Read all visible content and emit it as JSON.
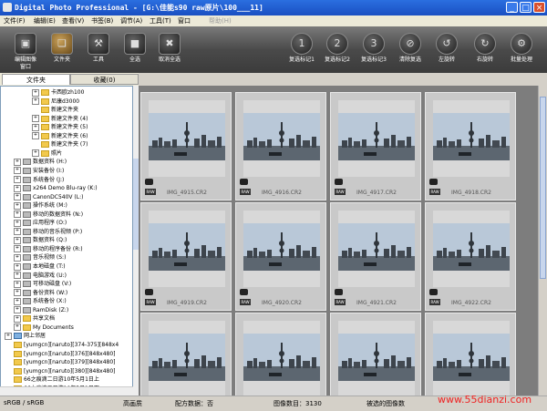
{
  "window": {
    "title": "Digital Photo Professional - [G:\\佳能s90 raw原片\\100___11]"
  },
  "menu": [
    {
      "label": "文件(F)",
      "enabled": true
    },
    {
      "label": "编辑(E)",
      "enabled": true
    },
    {
      "label": "查看(V)",
      "enabled": true
    },
    {
      "label": "书签(B)",
      "enabled": true
    },
    {
      "label": "调节(A)",
      "enabled": true
    },
    {
      "label": "工具(T)",
      "enabled": true
    },
    {
      "label": "窗口",
      "enabled": true
    },
    {
      "label": "帮助(H)",
      "enabled": false
    }
  ],
  "toolbar": {
    "left": [
      {
        "label": "编辑图像\n窗口",
        "icon": "edit-window-icon"
      },
      {
        "label": "文件夹",
        "icon": "folder-icon",
        "active": true
      },
      {
        "label": "工具",
        "icon": "tools-icon"
      },
      {
        "label": "全选",
        "icon": "select-all-icon"
      },
      {
        "label": "取消全选",
        "icon": "deselect-all-icon"
      }
    ],
    "right": [
      {
        "label": "复选标记1",
        "icon": "check-mark-1-icon"
      },
      {
        "label": "复选标记2",
        "icon": "check-mark-2-icon"
      },
      {
        "label": "复选标记3",
        "icon": "check-mark-3-icon"
      },
      {
        "label": "清除复选",
        "icon": "clear-check-icon"
      },
      {
        "label": "左旋转",
        "icon": "rotate-left-icon"
      },
      {
        "label": "右旋转",
        "icon": "rotate-right-icon"
      },
      {
        "label": "批量处理",
        "icon": "batch-process-icon"
      }
    ]
  },
  "tabs": [
    {
      "label": "文件夹",
      "active": true
    },
    {
      "label": "收藏(0)",
      "active": false
    }
  ],
  "tree": [
    {
      "label": "卡西欧zh100",
      "icon": "folder",
      "depth": 3,
      "expander": "+"
    },
    {
      "label": "尼康d3000",
      "icon": "folder",
      "depth": 3,
      "expander": "+"
    },
    {
      "label": "新建文件夹",
      "icon": "folder",
      "depth": 3,
      "expander": ""
    },
    {
      "label": "新建文件夹 (4)",
      "icon": "folder",
      "depth": 3,
      "expander": "+"
    },
    {
      "label": "新建文件夹 (5)",
      "icon": "folder",
      "depth": 3,
      "expander": "+"
    },
    {
      "label": "新建文件夹 (6)",
      "icon": "folder",
      "depth": 3,
      "expander": "+"
    },
    {
      "label": "新建文件夹 (7)",
      "icon": "folder",
      "depth": 3,
      "expander": ""
    },
    {
      "label": "照片",
      "icon": "folder",
      "depth": 3,
      "expander": "+"
    },
    {
      "label": "数据资料 (H:)",
      "icon": "drive",
      "depth": 1,
      "expander": "+"
    },
    {
      "label": "安装备份 (I:)",
      "icon": "drive",
      "depth": 1,
      "expander": "+"
    },
    {
      "label": "系统备份 (J:)",
      "icon": "drive",
      "depth": 1,
      "expander": "+"
    },
    {
      "label": "x264 Demo Blu-ray (K:)",
      "icon": "drive",
      "depth": 1,
      "expander": "+"
    },
    {
      "label": "CanonDC540V (L:)",
      "icon": "drive",
      "depth": 1,
      "expander": "+"
    },
    {
      "label": "操作系统 (M:)",
      "icon": "drive",
      "depth": 1,
      "expander": "+"
    },
    {
      "label": "移动的数据资料 (N:)",
      "icon": "drive",
      "depth": 1,
      "expander": "+"
    },
    {
      "label": "应用程序 (O:)",
      "icon": "drive",
      "depth": 1,
      "expander": "+"
    },
    {
      "label": "移动的音乐视频 (P:)",
      "icon": "drive",
      "depth": 1,
      "expander": "+"
    },
    {
      "label": "数据资料 (Q:)",
      "icon": "drive",
      "depth": 1,
      "expander": "+"
    },
    {
      "label": "移动的程序备份 (R:)",
      "icon": "drive",
      "depth": 1,
      "expander": "+"
    },
    {
      "label": "音乐视频 (S:)",
      "icon": "drive",
      "depth": 1,
      "expander": "+"
    },
    {
      "label": "本地磁盘 (T:)",
      "icon": "drive",
      "depth": 1,
      "expander": "+"
    },
    {
      "label": "电脑游戏 (U:)",
      "icon": "drive",
      "depth": 1,
      "expander": "+"
    },
    {
      "label": "可移动磁盘 (V:)",
      "icon": "drive",
      "depth": 1,
      "expander": "+"
    },
    {
      "label": "备份资料 (W:)",
      "icon": "drive",
      "depth": 1,
      "expander": "+"
    },
    {
      "label": "系统备份 (X:)",
      "icon": "drive",
      "depth": 1,
      "expander": "+"
    },
    {
      "label": "RamDisk (Z:)",
      "icon": "drive",
      "depth": 1,
      "expander": "+"
    },
    {
      "label": "共享文档",
      "icon": "folder",
      "depth": 1,
      "expander": "+"
    },
    {
      "label": "My Documents",
      "icon": "folder",
      "depth": 1,
      "expander": "+"
    },
    {
      "label": "网上邻居",
      "icon": "net",
      "depth": 0,
      "expander": "+"
    },
    {
      "label": "[yumgcn][naruto][374-375][848x4",
      "icon": "folder",
      "depth": 0,
      "expander": ""
    },
    {
      "label": "[yumgcn][naruto][376][848x480]",
      "icon": "folder",
      "depth": 0,
      "expander": ""
    },
    {
      "label": "[yumgcn][naruto][379][848x480]",
      "icon": "folder",
      "depth": 0,
      "expander": ""
    },
    {
      "label": "[yumgcn][naruto][380][848x480]",
      "icon": "folder",
      "depth": 0,
      "expander": ""
    },
    {
      "label": "66之痕滴二日游10年5月1日上",
      "icon": "folder",
      "depth": 0,
      "expander": ""
    },
    {
      "label": "66之痕滴二日游10年5月1日下",
      "icon": "folder",
      "depth": 0,
      "expander": ""
    }
  ],
  "thumbnails": [
    {
      "name": "IMG_4915.CR2"
    },
    {
      "name": "IMG_4916.CR2"
    },
    {
      "name": "IMG_4917.CR2"
    },
    {
      "name": "IMG_4918.CR2"
    },
    {
      "name": "IMG_4919.CR2"
    },
    {
      "name": "IMG_4920.CR2"
    },
    {
      "name": "IMG_4921.CR2"
    },
    {
      "name": "IMG_4922.CR2"
    },
    {
      "name": ""
    },
    {
      "name": ""
    },
    {
      "name": ""
    },
    {
      "name": ""
    }
  ],
  "thumb_badge": "RAW",
  "status": {
    "colorspace": "sRGB / sRGB",
    "quality": "高画质",
    "recipe": "配方数据：否",
    "count": "图像数目：3130",
    "selected": "被选的图像数"
  },
  "watermark": "www.55dianzi.com",
  "colors": {
    "titlebar": "#1a4fc2",
    "toolbar": "#4a4a4a",
    "grid_bg": "#7d7d7d",
    "watermark": "#e22222"
  }
}
